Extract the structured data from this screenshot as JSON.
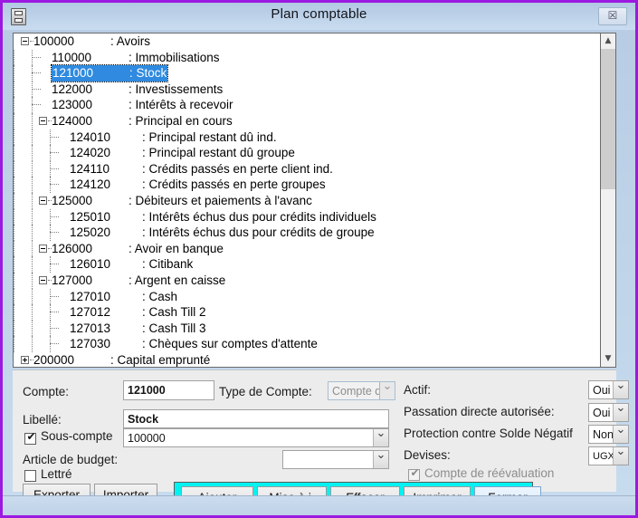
{
  "window": {
    "title": "Plan comptable",
    "app_icon": "accounts-book-icon",
    "close_label": "☒",
    "frame_color": "#9b19e0",
    "accent_color": "#00f2f2",
    "selection_color": "#2f8ae0"
  },
  "tree": {
    "scroll_up": "▲",
    "scroll_down": "▼",
    "rows": [
      {
        "code": "100000",
        "sep": ":",
        "label": "Avoirs",
        "depth": 0,
        "expander": "minus",
        "selected": false
      },
      {
        "code": "110000",
        "sep": ":",
        "label": "Immobilisations",
        "depth": 1,
        "expander": "none",
        "selected": false
      },
      {
        "code": "121000",
        "sep": ":",
        "label": "Stock",
        "depth": 1,
        "expander": "none",
        "selected": true
      },
      {
        "code": "122000",
        "sep": ":",
        "label": "Investissements",
        "depth": 1,
        "expander": "none",
        "selected": false
      },
      {
        "code": "123000",
        "sep": ":",
        "label": "Intérêts à recevoir",
        "depth": 1,
        "expander": "none",
        "selected": false
      },
      {
        "code": "124000",
        "sep": ":",
        "label": "Principal en cours",
        "depth": 1,
        "expander": "minus",
        "selected": false
      },
      {
        "code": "124010",
        "sep": ":",
        "label": "Principal restant dû ind.",
        "depth": 2,
        "expander": "none",
        "selected": false
      },
      {
        "code": "124020",
        "sep": ":",
        "label": "Principal restant dû groupe",
        "depth": 2,
        "expander": "none",
        "selected": false
      },
      {
        "code": "124110",
        "sep": ":",
        "label": "Crédits passés en perte client ind.",
        "depth": 2,
        "expander": "none",
        "selected": false
      },
      {
        "code": "124120",
        "sep": ":",
        "label": "Crédits passés en perte groupes",
        "depth": 2,
        "expander": "none",
        "selected": false
      },
      {
        "code": "125000",
        "sep": ":",
        "label": "Débiteurs et paiements à l'avanc",
        "depth": 1,
        "expander": "minus",
        "selected": false
      },
      {
        "code": "125010",
        "sep": ":",
        "label": "Intérêts échus dus pour crédits individuels",
        "depth": 2,
        "expander": "none",
        "selected": false
      },
      {
        "code": "125020",
        "sep": ":",
        "label": "Intérêts échus dus pour crédits de groupe",
        "depth": 2,
        "expander": "none",
        "selected": false
      },
      {
        "code": "126000",
        "sep": ":",
        "label": "Avoir en banque",
        "depth": 1,
        "expander": "minus",
        "selected": false
      },
      {
        "code": "126010",
        "sep": ":",
        "label": "Citibank",
        "depth": 2,
        "expander": "none",
        "selected": false
      },
      {
        "code": "127000",
        "sep": ":",
        "label": "Argent en caisse",
        "depth": 1,
        "expander": "minus",
        "selected": false
      },
      {
        "code": "127010",
        "sep": ":",
        "label": "Cash",
        "depth": 2,
        "expander": "none",
        "selected": false
      },
      {
        "code": "127012",
        "sep": ":",
        "label": "Cash Till 2",
        "depth": 2,
        "expander": "none",
        "selected": false
      },
      {
        "code": "127013",
        "sep": ":",
        "label": "Cash Till 3",
        "depth": 2,
        "expander": "none",
        "selected": false
      },
      {
        "code": "127030",
        "sep": ":",
        "label": "Chèques sur comptes d'attente",
        "depth": 2,
        "expander": "none",
        "selected": false
      },
      {
        "code": "200000",
        "sep": ":",
        "label": "Capital emprunté",
        "depth": 0,
        "expander": "plus",
        "selected": false
      }
    ]
  },
  "form": {
    "compte_label": "Compte:",
    "compte_value": "121000",
    "type_compte_label": "Type de Compte:",
    "type_compte_value": "Compte de",
    "libelle_label": "Libellé:",
    "libelle_value": "Stock",
    "sous_compte_label": "Sous-compte",
    "sous_compte_checked": true,
    "sous_compte_value": "100000",
    "article_budget_label": "Article de budget:",
    "article_budget_value": "",
    "lettre_label": "Lettré",
    "lettre_checked": false,
    "actif_label": "Actif:",
    "actif_value": "Oui",
    "passation_label": "Passation directe autorisée:",
    "passation_value": "Oui",
    "protection_label": "Protection contre Solde Négatif",
    "protection_value": "Non",
    "devises_label": "Devises:",
    "devises_value": "UGX",
    "reevaluation_label": "Compte de réévaluation",
    "reevaluation_checked": true
  },
  "buttons": {
    "exporter": "Exporter",
    "importer": "Importer",
    "ajouter": "Ajouter",
    "mise_a_j": "Mise à j.",
    "effacer": "Effacer",
    "imprimer": "Imprimer",
    "fermer": "Fermer"
  }
}
